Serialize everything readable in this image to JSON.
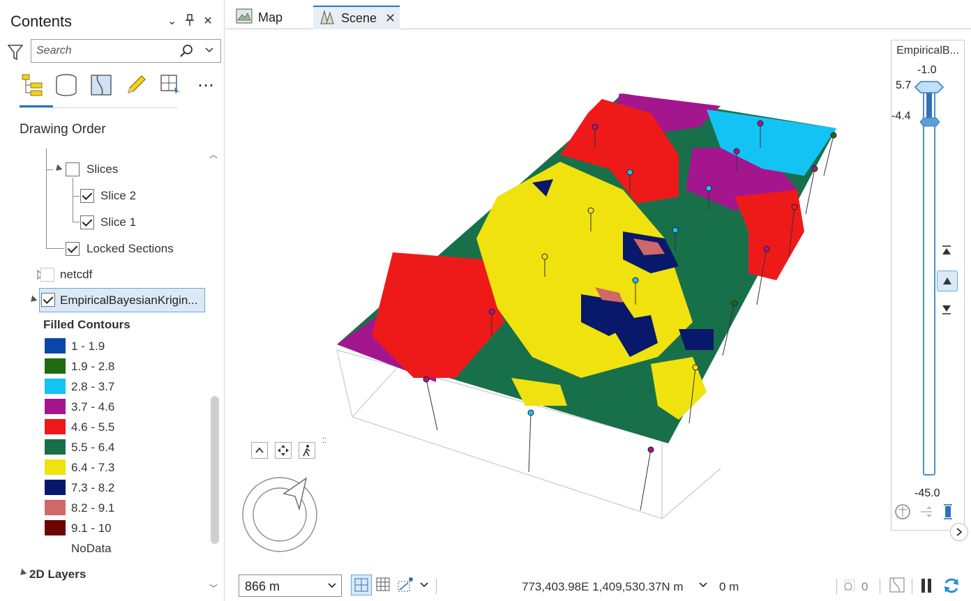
{
  "contents": {
    "title": "Contents",
    "search_placeholder": "Search",
    "section_title": "Drawing Order",
    "tree": {
      "slices": "Slices",
      "slice2": "Slice 2",
      "slice1": "Slice 1",
      "locked_sections": "Locked Sections",
      "netcdf": "netcdf",
      "ebk_layer": "EmpiricalBayesianKrigin..."
    },
    "legend": {
      "heading": "Filled Contours",
      "items": [
        {
          "label": "1 - 1.9",
          "color": "#0a47a8"
        },
        {
          "label": "1.9 - 2.8",
          "color": "#1e6b10"
        },
        {
          "label": "2.8 - 3.7",
          "color": "#13c3f3"
        },
        {
          "label": "3.7 - 4.6",
          "color": "#a4168e"
        },
        {
          "label": "4.6 - 5.5",
          "color": "#ee1a1a"
        },
        {
          "label": "5.5 - 6.4",
          "color": "#18704a"
        },
        {
          "label": "6.4 - 7.3",
          "color": "#efe20e"
        },
        {
          "label": "7.3 - 8.2",
          "color": "#08186a"
        },
        {
          "label": "8.2 - 9.1",
          "color": "#cf6868"
        },
        {
          "label": "9.1 - 10",
          "color": "#6d0505"
        },
        {
          "label": "NoData",
          "color": ""
        }
      ]
    },
    "layers_2d": "2D Layers"
  },
  "tabs": [
    {
      "label": "Map",
      "active": false
    },
    {
      "label": "Scene",
      "active": true
    }
  ],
  "range_slider": {
    "title": "EmpiricalB...",
    "max_label": "-1.0",
    "upper_value": "5.7",
    "lower_value": "-4.4",
    "min_label": "-45.0"
  },
  "status_bar": {
    "scale": "866 m",
    "coordinates": "773,403.98E 1,409,530.37N m",
    "elevation": "0 m",
    "selection_count": "0"
  },
  "icons": {
    "filter": "filter-icon",
    "search": "search-icon",
    "list_by_drawing_order": "drawing-order-icon",
    "list_by_source": "database-icon",
    "list_by_snapping": "snapping-icon",
    "list_by_editing": "pencil-icon",
    "list_by_selection": "selection-icon",
    "navigator": "compass-icon"
  }
}
